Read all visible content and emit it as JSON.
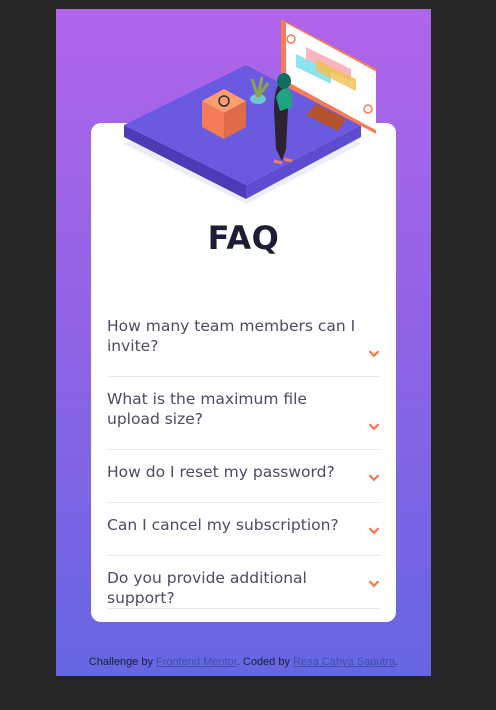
{
  "title": "FAQ",
  "faqs": [
    {
      "question": "How many team members can I invite?"
    },
    {
      "question": "What is the maximum file upload size?"
    },
    {
      "question": "How do I reset my password?"
    },
    {
      "question": "Can I cancel my subscription?"
    },
    {
      "question": "Do you provide additional support?"
    }
  ],
  "icons": {
    "toggle": "chevron-down-icon",
    "illustration": "woman-online-illustration"
  },
  "colors": {
    "accent": "#f47c57",
    "title": "#1d1e35",
    "question": "#4b4c5f",
    "gradient_top": "#b064ea",
    "gradient_bottom": "#6566e3"
  },
  "footer": {
    "prefix": "Challenge by ",
    "link1": "Frontend Mentor",
    "middle": ". Coded by ",
    "link2": "Resa Cahya Saputra",
    "suffix": "."
  }
}
